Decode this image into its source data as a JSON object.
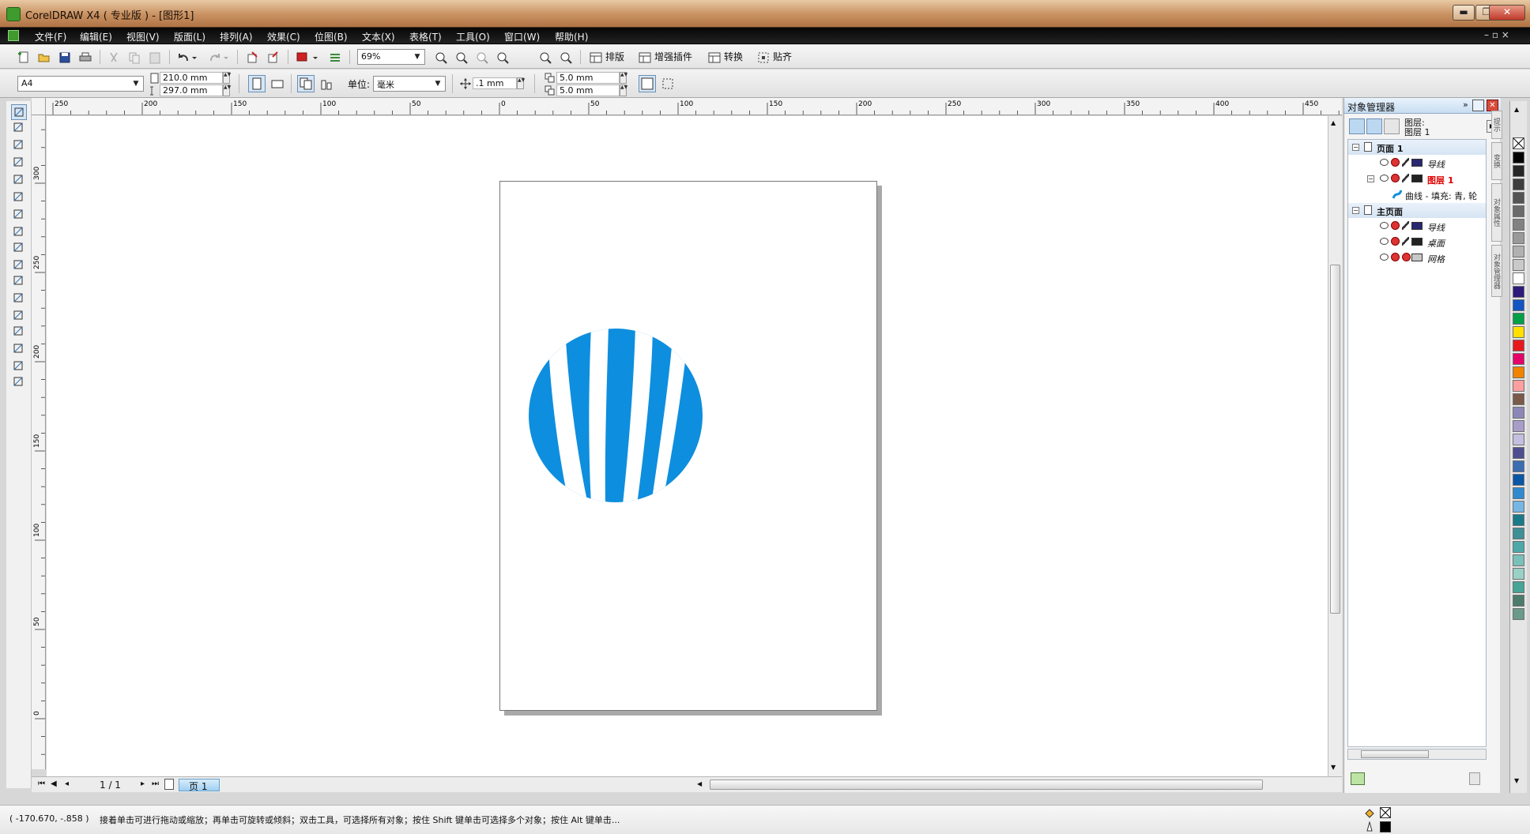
{
  "window": {
    "title": "CorelDRAW X4 ( 专业版 ) - [图形1]",
    "minimize": "▬",
    "restore": "❐",
    "close": "✕"
  },
  "menu": {
    "items": [
      "文件(F)",
      "编辑(E)",
      "视图(V)",
      "版面(L)",
      "排列(A)",
      "效果(C)",
      "位图(B)",
      "文本(X)",
      "表格(T)",
      "工具(O)",
      "窗口(W)",
      "帮助(H)"
    ],
    "child_controls": "– ▫ ×"
  },
  "toolbar": {
    "zoom": "69%",
    "buttons": [
      {
        "name": "layout-button",
        "label": "排版"
      },
      {
        "name": "enhance-plugin-button",
        "label": "增强插件"
      },
      {
        "name": "convert-button",
        "label": "转换"
      },
      {
        "name": "snap-button",
        "label": "贴齐"
      }
    ]
  },
  "propbar": {
    "paper": "A4",
    "width": "210.0 mm",
    "height": "297.0 mm",
    "units_label": "单位:",
    "units": "毫米",
    "nudge": ".1 mm",
    "dup_x": "5.0 mm",
    "dup_y": "5.0 mm"
  },
  "rulers": {
    "h_labels": [
      "250",
      "200",
      "150",
      "100",
      "50",
      "0",
      "50",
      "100",
      "150",
      "200",
      "250",
      "300",
      "350",
      "400",
      "450"
    ],
    "v_labels": [
      "300",
      "250",
      "200",
      "150",
      "100",
      "50",
      "0"
    ],
    "units": "毫米"
  },
  "canvas": {
    "logo_color": "#0e8ede",
    "page_color": "#ffffff"
  },
  "page_nav": {
    "counter": "1 / 1",
    "tab": "页 1"
  },
  "status": {
    "coords": "( -170.670, -.858 )",
    "hint": "接着单击可进行拖动或缩放；再单击可旋转或倾斜；双击工具，可选择所有对象；按住 Shift 键单击可选择多个对象；按住 Alt 键单击..."
  },
  "object_manager": {
    "title": "对象管理器",
    "layer_info": [
      "图层:",
      "图层 1"
    ],
    "tree": [
      {
        "type": "page",
        "label": "页面 1"
      },
      {
        "type": "layer",
        "label": "导线",
        "color": "#2a2870"
      },
      {
        "type": "layer-active",
        "label": "图层 1",
        "color": "#222222"
      },
      {
        "type": "object",
        "label": "曲线 - 填充: 青, 轮"
      },
      {
        "type": "page",
        "label": "主页面"
      },
      {
        "type": "layer",
        "label": "导线",
        "color": "#2a2870"
      },
      {
        "type": "layer",
        "label": "桌面",
        "color": "#222222"
      },
      {
        "type": "layer-grid",
        "label": "网格",
        "color": "#c8c8c8"
      }
    ],
    "side_tabs": [
      "提示",
      "变换",
      "对象属性",
      "对象管理器"
    ]
  },
  "palette": {
    "colors": [
      "#000000",
      "#262626",
      "#3d3d3d",
      "#545454",
      "#6b6b6b",
      "#828282",
      "#9a9a9a",
      "#b1b1b1",
      "#c9c9c9",
      "#ffffff",
      "#2d1a7a",
      "#1255c3",
      "#00a046",
      "#ffe000",
      "#e8191d",
      "#e5006a",
      "#f08300",
      "#ff9f9f",
      "#7a5a49",
      "#8d87b8",
      "#a89dc9",
      "#c4bee0",
      "#4d4f8f",
      "#3b6db2",
      "#0a57a6",
      "#2f8bd0",
      "#76b6e3",
      "#1b7a89",
      "#3f8f96",
      "#4fa8a8",
      "#79c0b9",
      "#9ad1c6",
      "#46a596",
      "#4c7b6c",
      "#6a9a89"
    ]
  }
}
